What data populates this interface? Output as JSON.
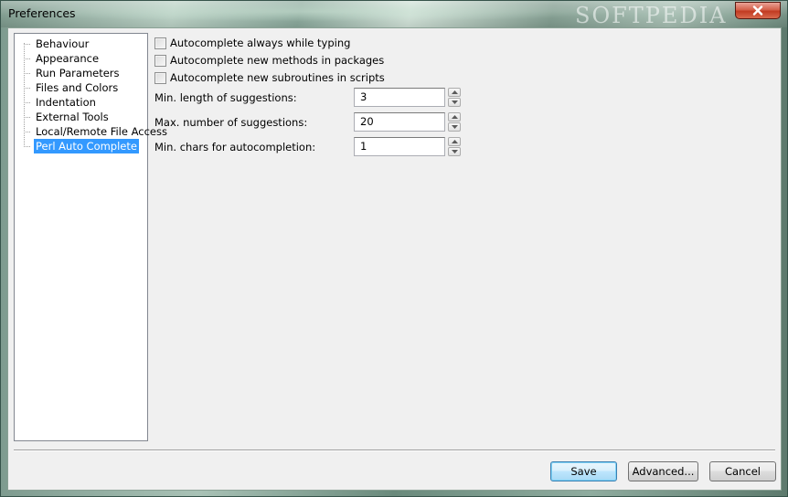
{
  "window": {
    "title": "Preferences",
    "watermark": "SOFTPEDIA"
  },
  "tree": {
    "items": [
      {
        "label": "Behaviour",
        "selected": false
      },
      {
        "label": "Appearance",
        "selected": false
      },
      {
        "label": "Run Parameters",
        "selected": false
      },
      {
        "label": "Files and Colors",
        "selected": false
      },
      {
        "label": "Indentation",
        "selected": false
      },
      {
        "label": "External Tools",
        "selected": false
      },
      {
        "label": "Local/Remote File Access",
        "selected": false
      },
      {
        "label": "Perl Auto Complete",
        "selected": true
      }
    ]
  },
  "options": {
    "checkboxes": [
      {
        "label": "Autocomplete always while typing",
        "checked": false
      },
      {
        "label": "Autocomplete new methods in packages",
        "checked": false
      },
      {
        "label": "Autocomplete new subroutines in scripts",
        "checked": false
      }
    ],
    "fields": [
      {
        "label": "Min. length of suggestions:",
        "value": "3"
      },
      {
        "label": "Max. number of suggestions:",
        "value": "20"
      },
      {
        "label": "Min. chars for autocompletion:",
        "value": "1"
      }
    ]
  },
  "buttons": {
    "save": "Save",
    "advanced": "Advanced...",
    "cancel": "Cancel"
  },
  "icons": {
    "close": "close-icon",
    "spin_up": "chevron-up-icon",
    "spin_down": "chevron-down-icon"
  },
  "colors": {
    "selection": "#3399ff",
    "close_button": "#c23b22",
    "dialog_background": "#f0f0f0"
  }
}
